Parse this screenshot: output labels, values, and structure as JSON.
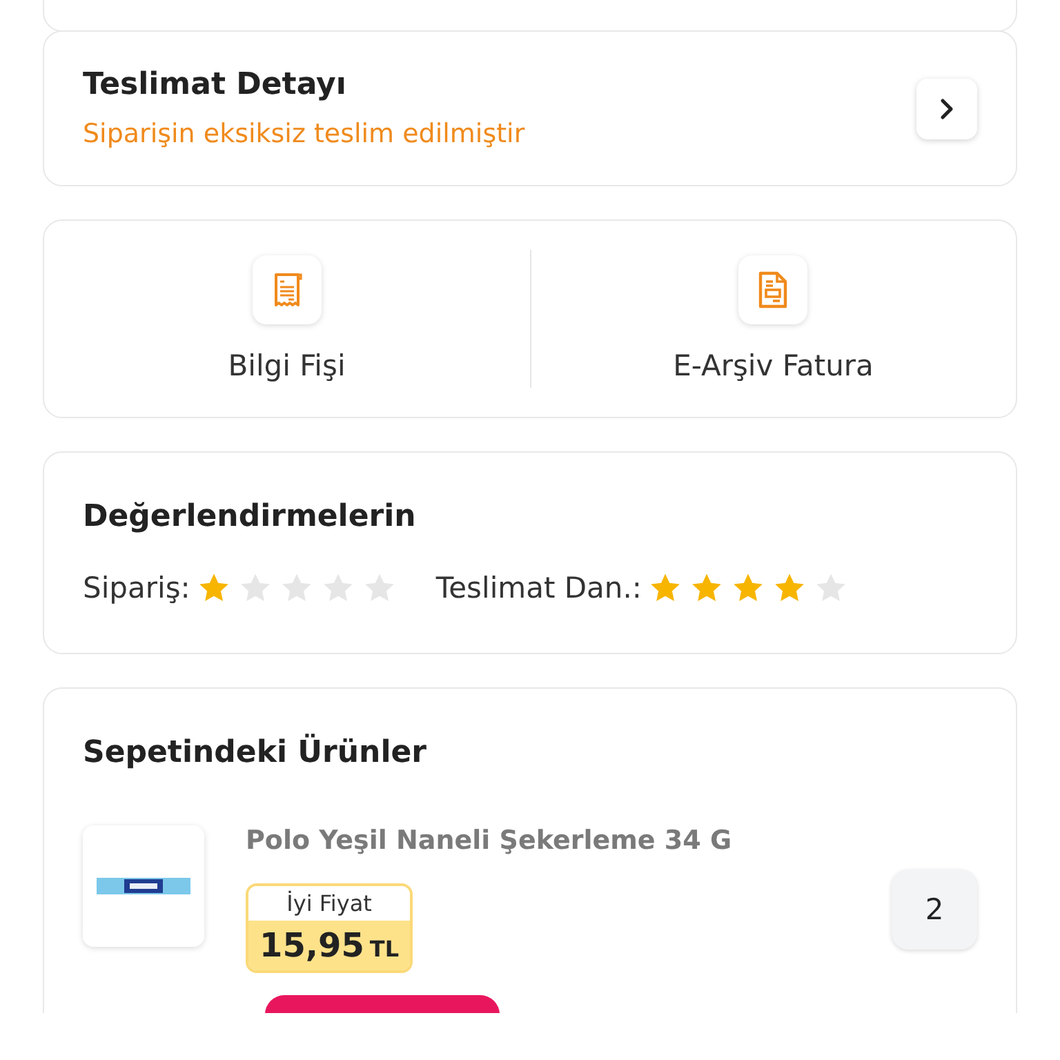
{
  "delivery": {
    "title": "Teslimat Detayı",
    "status": "Siparişin eksiksiz teslim edilmiştir"
  },
  "documents": [
    {
      "kind": "receipt",
      "label": "Bilgi Fişi"
    },
    {
      "kind": "invoice",
      "label": "E-Arşiv Fatura"
    }
  ],
  "ratings": {
    "title": "Değerlendirmelerin",
    "items": [
      {
        "label": "Sipariş:",
        "stars": 1
      },
      {
        "label": "Teslimat Dan.:",
        "stars": 4
      }
    ]
  },
  "basket": {
    "title": "Sepetindeki Ürünler",
    "products": [
      {
        "kind": "picture",
        "name": "Polo Yeşil Naneli Şekerleme 34 G",
        "price_tag": "İyi Fiyat",
        "price": "15,95",
        "currency": "TL",
        "quantity": "2"
      }
    ]
  }
}
